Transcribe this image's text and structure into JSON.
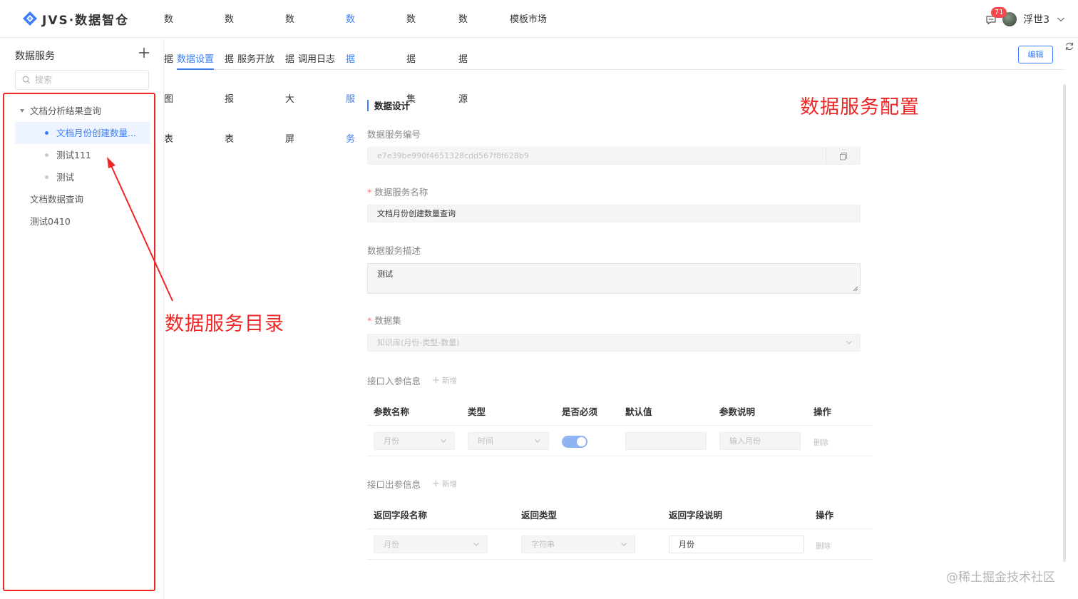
{
  "app": {
    "logo_text": "JVS·数据智仓",
    "nav": [
      "数据图表",
      "数据报表",
      "数据大屏",
      "数据服务",
      "数据集",
      "数据源",
      "模板市场"
    ],
    "active_nav": "数据服务",
    "badge_count": "71",
    "user_name": "浮世3"
  },
  "sidebar": {
    "title": "数据服务",
    "search_placeholder": "搜索",
    "tree": [
      {
        "label": "文档分析结果查询",
        "level": 0,
        "expanded": true
      },
      {
        "label": "文档月份创建数量...",
        "level": 1,
        "selected": true
      },
      {
        "label": "测试111",
        "level": 1
      },
      {
        "label": "测试",
        "level": 1
      },
      {
        "label": "文档数据查询",
        "level": 0
      },
      {
        "label": "测试0410",
        "level": 0
      }
    ]
  },
  "tabs": [
    "数据设置",
    "服务开放",
    "调用日志"
  ],
  "active_tab": "数据设置",
  "edit_label": "编辑",
  "form": {
    "section_title": "数据设计",
    "service_id_label": "数据服务编号",
    "service_id_value": "e7e39be990f4651328cdd567f8f628b9",
    "service_name_label": "数据服务名称",
    "service_name_value": "文档月份创建数量查询",
    "service_desc_label": "数据服务描述",
    "service_desc_value": "测试",
    "dataset_label": "数据集",
    "dataset_value": "知识库(月份-类型-数量)",
    "input_params_label": "接口入参信息",
    "output_params_label": "接口出参信息",
    "add_label": "新增",
    "input_table": {
      "headers": [
        "参数名称",
        "类型",
        "是否必须",
        "默认值",
        "参数说明",
        "操作"
      ],
      "rows": [
        {
          "name": "月份",
          "type": "时间",
          "required": true,
          "default": "",
          "desc_placeholder": "输入月份",
          "action": "删除"
        }
      ]
    },
    "output_table": {
      "headers": [
        "返回字段名称",
        "返回类型",
        "返回字段说明",
        "操作"
      ],
      "rows": [
        {
          "name": "月份",
          "type": "字符串",
          "desc": "月份",
          "action": "删除"
        }
      ]
    }
  },
  "annotations": {
    "catalog": "数据服务目录",
    "config": "数据服务配置",
    "color": "#f02626"
  },
  "watermark": "@稀土掘金技术社区",
  "colors": {
    "accent": "#3b7ef7",
    "annotation": "#f02626"
  }
}
